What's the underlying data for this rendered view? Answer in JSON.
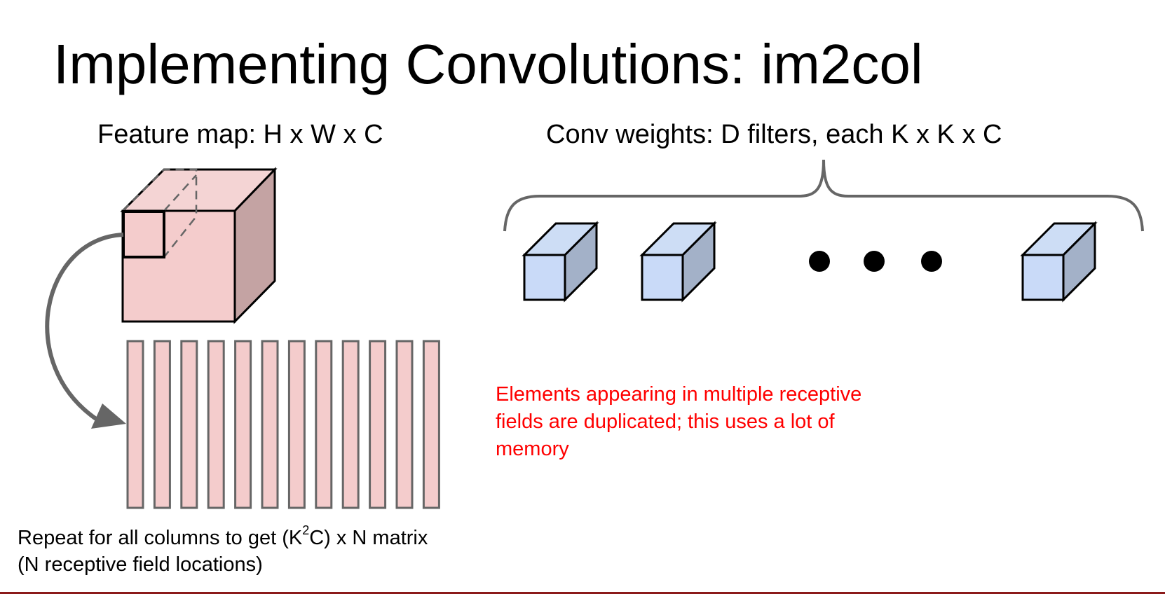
{
  "slide": {
    "title": "Implementing Convolutions: im2col",
    "feature_map_label": "Feature map: H x W x C",
    "weights_label": "Conv weights: D filters, each K x K x C",
    "note": "Elements appearing in multiple receptive fields are duplicated; this uses a lot of memory",
    "caption": {
      "line1_prefix": "Repeat for all columns to get (K",
      "line1_sup": "2",
      "line1_suffix": "C) x N matrix",
      "line2": "(N receptive field locations)"
    }
  },
  "colors": {
    "feature_front": "#f4cccc",
    "feature_top": "#f4d4d4",
    "feature_side": "#c4a3a3",
    "filter_front": "#c9daf8",
    "filter_top": "#cdddf5",
    "filter_side": "#a3b1c8",
    "arrow": "#666666",
    "note": "#ff0000",
    "rule": "#8b1a1a"
  },
  "icons": {
    "feature_map": "cube-icon",
    "filters": "cube-icon",
    "ellipsis": "three-dots"
  },
  "column_count": 12,
  "filter_count_drawn": 3
}
